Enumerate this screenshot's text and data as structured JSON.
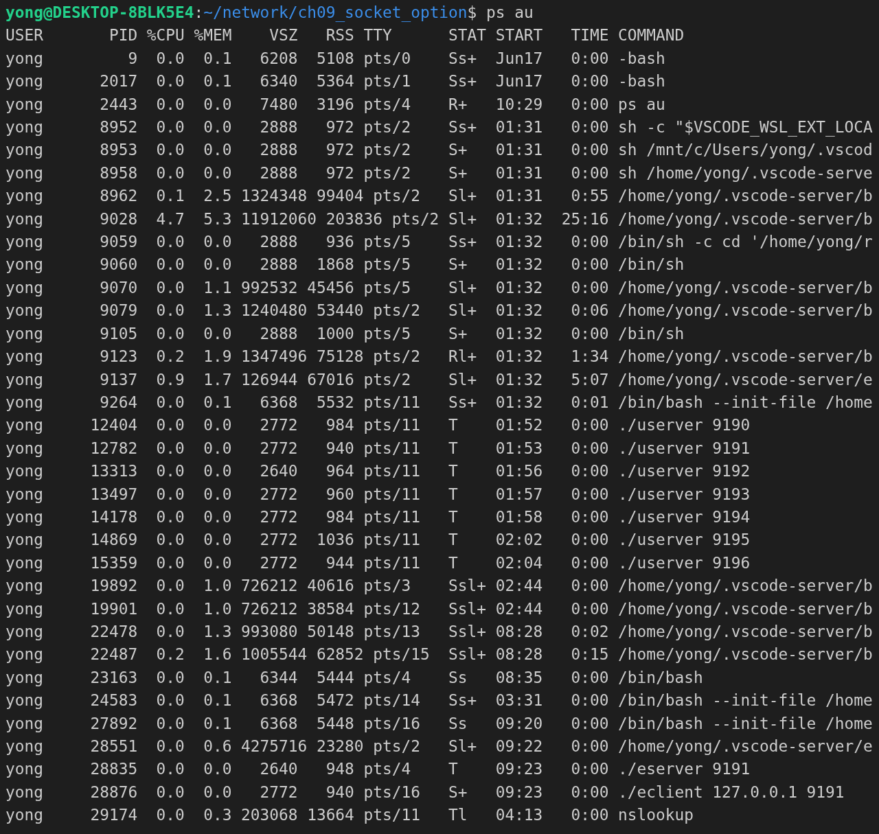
{
  "prompt": {
    "user_host": "yong@DESKTOP-8BLK5E4",
    "separator": ":",
    "path": "~/network/ch09_socket_option",
    "symbol": "$",
    "command": " ps au"
  },
  "header": "USER       PID %CPU %MEM    VSZ   RSS TTY      STAT START   TIME COMMAND",
  "lines": [
    "yong         9  0.0  0.1   6208  5108 pts/0    Ss+  Jun17   0:00 -bash",
    "yong      2017  0.0  0.1   6340  5364 pts/1    Ss+  Jun17   0:00 -bash",
    "yong      2443  0.0  0.0   7480  3196 pts/4    R+   10:29   0:00 ps au",
    "yong      8952  0.0  0.0   2888   972 pts/2    Ss+  01:31   0:00 sh -c \"$VSCODE_WSL_EXT_LOCA",
    "yong      8953  0.0  0.0   2888   972 pts/2    S+   01:31   0:00 sh /mnt/c/Users/yong/.vscod",
    "yong      8958  0.0  0.0   2888   972 pts/2    S+   01:31   0:00 sh /home/yong/.vscode-serve",
    "yong      8962  0.1  2.5 1324348 99404 pts/2   Sl+  01:31   0:55 /home/yong/.vscode-server/b",
    "yong      9028  4.7  5.3 11912060 203836 pts/2 Sl+  01:32  25:16 /home/yong/.vscode-server/b",
    "yong      9059  0.0  0.0   2888   936 pts/5    Ss+  01:32   0:00 /bin/sh -c cd '/home/yong/r",
    "yong      9060  0.0  0.0   2888  1868 pts/5    S+   01:32   0:00 /bin/sh",
    "yong      9070  0.0  1.1 992532 45456 pts/5    Sl+  01:32   0:00 /home/yong/.vscode-server/b",
    "yong      9079  0.0  1.3 1240480 53440 pts/2   Sl+  01:32   0:06 /home/yong/.vscode-server/b",
    "yong      9105  0.0  0.0   2888  1000 pts/5    S+   01:32   0:00 /bin/sh",
    "yong      9123  0.2  1.9 1347496 75128 pts/2   Rl+  01:32   1:34 /home/yong/.vscode-server/b",
    "yong      9137  0.9  1.7 126944 67016 pts/2    Sl+  01:32   5:07 /home/yong/.vscode-server/e",
    "yong      9264  0.0  0.1   6368  5532 pts/11   Ss+  01:32   0:01 /bin/bash --init-file /home",
    "yong     12404  0.0  0.0   2772   984 pts/11   T    01:52   0:00 ./userver 9190",
    "yong     12782  0.0  0.0   2772   940 pts/11   T    01:53   0:00 ./userver 9191",
    "yong     13313  0.0  0.0   2640   964 pts/11   T    01:56   0:00 ./userver 9192",
    "yong     13497  0.0  0.0   2772   960 pts/11   T    01:57   0:00 ./userver 9193",
    "yong     14178  0.0  0.0   2772   984 pts/11   T    01:58   0:00 ./userver 9194",
    "yong     14869  0.0  0.0   2772  1036 pts/11   T    02:02   0:00 ./userver 9195",
    "yong     15359  0.0  0.0   2772   944 pts/11   T    02:04   0:00 ./userver 9196",
    "yong     19892  0.0  1.0 726212 40616 pts/3    Ssl+ 02:44   0:00 /home/yong/.vscode-server/b",
    "yong     19901  0.0  1.0 726212 38584 pts/12   Ssl+ 02:44   0:00 /home/yong/.vscode-server/b",
    "yong     22478  0.0  1.3 993080 50148 pts/13   Ssl+ 08:28   0:02 /home/yong/.vscode-server/b",
    "yong     22487  0.2  1.6 1005544 62852 pts/15  Ssl+ 08:28   0:15 /home/yong/.vscode-server/b",
    "yong     23163  0.0  0.1   6344  5444 pts/4    Ss   08:35   0:00 /bin/bash",
    "yong     24583  0.0  0.1   6368  5472 pts/14   Ss+  03:31   0:00 /bin/bash --init-file /home",
    "yong     27892  0.0  0.1   6368  5448 pts/16   Ss   09:20   0:00 /bin/bash --init-file /home",
    "yong     28551  0.0  0.6 4275716 23280 pts/2   Sl+  09:22   0:00 /home/yong/.vscode-server/e",
    "yong     28835  0.0  0.0   2640   948 pts/4    T    09:23   0:00 ./eserver 9191",
    "yong     28876  0.0  0.0   2772   940 pts/16   S+   09:23   0:00 ./eclient 127.0.0.1 9191",
    "yong     29174  0.0  0.3 203068 13664 pts/11   Tl   04:13   0:00 nslookup"
  ]
}
